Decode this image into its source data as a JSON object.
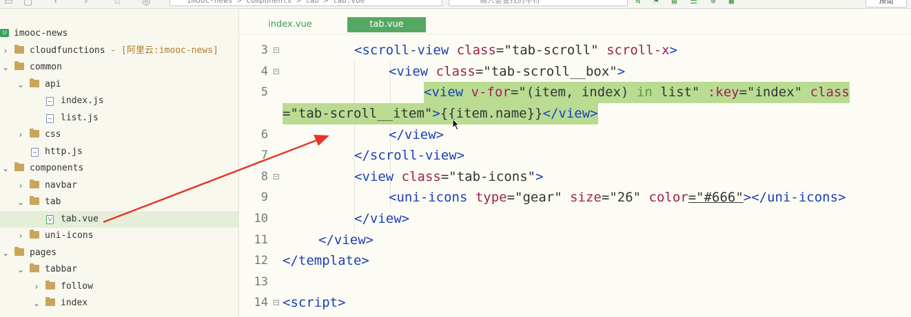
{
  "toolbar": {
    "path_text": "imooc-news > components > tab > tab.vue",
    "search_placeholder": "输入要查找的字符",
    "preview_label": "预览"
  },
  "sidebar": {
    "items": [
      {
        "label": "imooc-news",
        "type": "project",
        "icon": "project-icon",
        "expanded": true
      },
      {
        "label": "cloudfunctions",
        "note": " - [阿里云:imooc-news]",
        "type": "folder",
        "icon": "folder-icon",
        "expanded": false
      },
      {
        "label": "common",
        "type": "folder",
        "icon": "folder-icon",
        "expanded": true
      },
      {
        "label": "api",
        "type": "folder",
        "icon": "folder-icon",
        "expanded": true
      },
      {
        "label": "index.js",
        "type": "file",
        "icon": "js-file-icon"
      },
      {
        "label": "list.js",
        "type": "file",
        "icon": "js-file-icon"
      },
      {
        "label": "css",
        "type": "folder",
        "icon": "folder-icon",
        "expanded": false
      },
      {
        "label": "http.js",
        "type": "file",
        "icon": "js-file-icon"
      },
      {
        "label": "components",
        "type": "folder",
        "icon": "folder-icon",
        "expanded": true
      },
      {
        "label": "navbar",
        "type": "folder",
        "icon": "folder-icon",
        "expanded": false
      },
      {
        "label": "tab",
        "type": "folder",
        "icon": "folder-icon",
        "expanded": true
      },
      {
        "label": "tab.vue",
        "type": "vue",
        "icon": "vue-file-icon",
        "selected": true
      },
      {
        "label": "uni-icons",
        "type": "folder",
        "icon": "folder-icon",
        "expanded": false
      },
      {
        "label": "pages",
        "type": "folder",
        "icon": "folder-icon",
        "expanded": true
      },
      {
        "label": "tabbar",
        "type": "folder",
        "icon": "folder-icon",
        "expanded": true
      },
      {
        "label": "follow",
        "type": "folder",
        "icon": "folder-icon",
        "expanded": false
      },
      {
        "label": "index",
        "type": "folder",
        "icon": "folder-icon",
        "expanded": true
      }
    ]
  },
  "editor": {
    "tabs": [
      {
        "label": "index.vue",
        "active": false
      },
      {
        "label": "tab.vue",
        "active": true
      }
    ],
    "line_numbers": [
      "3",
      "4",
      "5",
      "",
      "6",
      "7",
      "8",
      "9",
      "10",
      "11",
      "12",
      "13",
      "14"
    ],
    "lines": {
      "l3": {
        "open": "<scroll-view",
        "attr1": " class",
        "eq1": "=\"tab-scroll\"",
        "attr2": " scroll-x",
        "close": ">"
      },
      "l4": {
        "open": "<view",
        "attr1": " class",
        "eq1": "=\"tab-scroll__box\"",
        "close": ">"
      },
      "l5": {
        "open": "<view",
        "attr1": " v-for",
        "eq1": "=\"(item, index) ",
        "kw": "in",
        "eq1b": " list\"",
        "attr2": " :key",
        "eq2": "=\"index\"",
        "attr3": " class"
      },
      "l5b": {
        "eq3": "=\"tab-scroll__item\"",
        "close": ">",
        "text": "{{item.name}}",
        "end": "</view>"
      },
      "l6": {
        "end": "</view>"
      },
      "l7": {
        "end": "</scroll-view>"
      },
      "l8": {
        "open": "<view",
        "attr1": " class",
        "eq1": "=\"tab-icons\"",
        "close": ">"
      },
      "l9": {
        "open": "<uni-icons",
        "attr1": " type",
        "eq1": "=\"gear\"",
        "attr2": " size",
        "eq2": "=\"26\"",
        "attr3": " color",
        "eq3": "=\"#666\"",
        "close": "></uni-icons>"
      },
      "l10": {
        "end": "</view>"
      },
      "l11": {
        "end": "</view>"
      },
      "l12": {
        "end": "</template>"
      },
      "l14": {
        "open": "<script>"
      }
    }
  },
  "colors": {
    "accent_green": "#55a861",
    "selection_highlight": "#b9dc92",
    "tag_blue": "#1a3fb8",
    "attr_maroon": "#9a2250",
    "arrow_red": "#e8352a"
  }
}
